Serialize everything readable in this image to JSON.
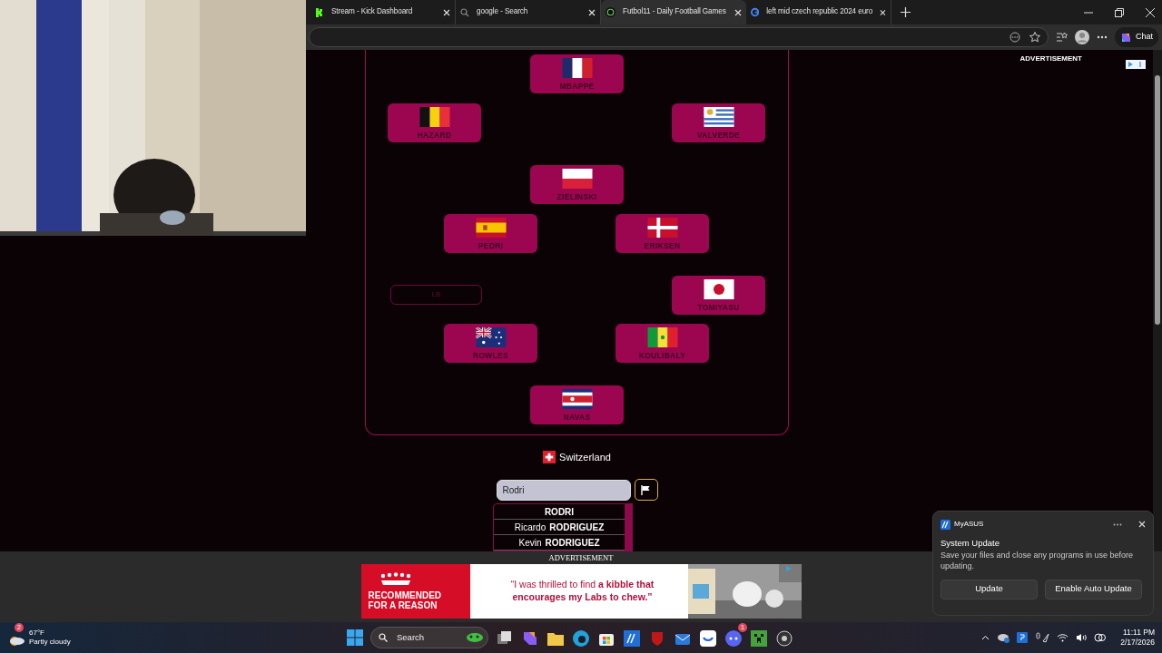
{
  "browser": {
    "tabs": [
      {
        "title": "Stream - Kick Dashboard",
        "selected": false
      },
      {
        "title": "google - Search",
        "selected": false
      },
      {
        "title": "Futbol11 - Daily Football Games",
        "selected": true
      },
      {
        "title": "left mid czech republic 2024 euro",
        "selected": false
      }
    ],
    "chat_button": "Chat"
  },
  "page": {
    "side_ad_label": "ADVERTISEMENT",
    "formation": {
      "rows": [
        {
          "center": {
            "kind": "player",
            "name": "MBAPPE"
          }
        },
        {
          "left_wide": {
            "kind": "player",
            "name": "HAZARD"
          },
          "right_wide": {
            "kind": "player",
            "name": "VALVERDE"
          }
        },
        {
          "center": {
            "kind": "player",
            "name": "ZIELINSKI"
          }
        },
        {
          "left": {
            "kind": "player",
            "name": "PEDRI"
          },
          "right": {
            "kind": "player",
            "name": "ERIKSEN"
          }
        },
        {
          "left_wide": {
            "kind": "empty",
            "placeholder": "LB"
          },
          "right_wide": {
            "kind": "player",
            "name": "TOMIYASU"
          }
        },
        {
          "left": {
            "kind": "player",
            "name": "ROWLES"
          },
          "right": {
            "kind": "player",
            "name": "KOULIBALY"
          }
        },
        {
          "center": {
            "kind": "player",
            "name": "NAVAS"
          }
        }
      ]
    },
    "country": {
      "name": "Switzerland"
    },
    "search": {
      "value": "Rodri"
    },
    "suggestions": [
      {
        "last": "RODRI"
      },
      {
        "first": "Ricardo",
        "last": "RODRIGUEZ"
      },
      {
        "first": "Kevin",
        "last": "RODRIGUEZ"
      }
    ],
    "bottom_ad": {
      "label": "ADVERTISEMENT",
      "headline": "RECOMMENDED FOR A REASON",
      "quote": "“I was thrilled to find **a kibble that encourages my Labs to chew.”**"
    }
  },
  "notification": {
    "app": "MyASUS",
    "title": "System Update",
    "body": "Save your files and close any programs in use before updating.",
    "buttons": [
      "Update",
      "Enable Auto Update"
    ]
  },
  "taskbar": {
    "weather": {
      "badge": "2",
      "temperature": "67°F",
      "condition": "Partly cloudy"
    },
    "search": {
      "placeholder": "Search"
    },
    "chat_app_badge": "1",
    "clock": {
      "time": "11:11 PM",
      "date": "2/17/2026"
    }
  }
}
